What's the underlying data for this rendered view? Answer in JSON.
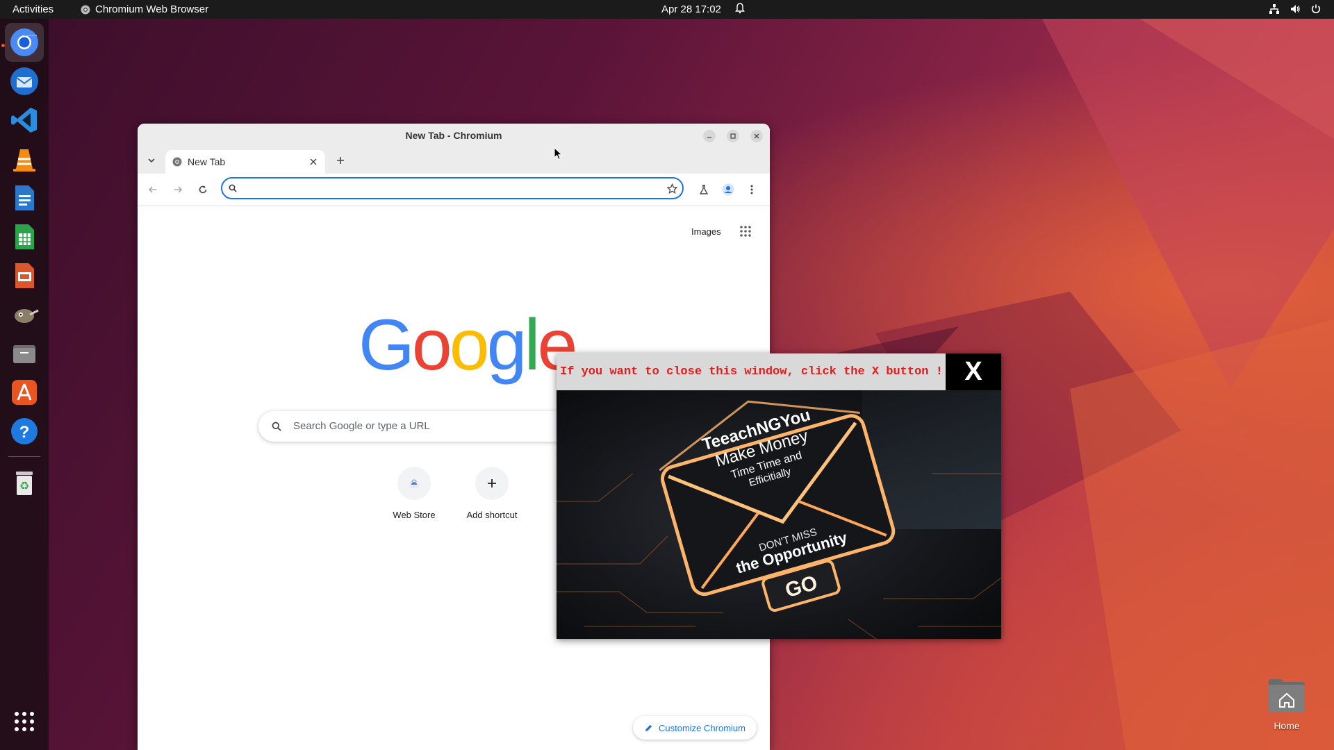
{
  "topbar": {
    "activities": "Activities",
    "app_name": "Chromium Web Browser",
    "clock": "Apr 28  17:02"
  },
  "dock": {
    "items": [
      "chromium-icon",
      "thunderbird-icon",
      "vscode-icon",
      "vlc-icon",
      "writer-icon",
      "calc-icon",
      "impress-icon",
      "gimp-icon",
      "files-icon",
      "app-center-icon",
      "help-icon",
      "trash-icon",
      "show-apps-icon"
    ]
  },
  "window": {
    "title": "New Tab - Chromium",
    "tab_label": "New Tab",
    "omnibox_value": ""
  },
  "ntp": {
    "images_link": "Images",
    "search_placeholder": "Search Google or type a URL",
    "logo": [
      "G",
      "o",
      "o",
      "g",
      "l",
      "e"
    ],
    "shortcuts": [
      {
        "label": "Web Store"
      },
      {
        "label": "Add shortcut"
      }
    ],
    "customize_label": "Customize Chromium"
  },
  "popup": {
    "message": "If you want to close this window, click the X button !",
    "close_label": "X",
    "art_text": {
      "line1": "TeeachNGYou",
      "line2": "Make Money",
      "line3": "Time Time and",
      "line4": "Efficitially",
      "line5": "DON'T MISS",
      "line6": "the Opportunity",
      "go": "GO"
    }
  },
  "desktop": {
    "home_label": "Home"
  },
  "colors": {
    "topbar": "#1b1b1b",
    "accent_blue": "#1a73e8",
    "popup_message": "#e31b1b",
    "google_blue": "#4285f4",
    "google_red": "#ea4335",
    "google_yellow": "#fbbc05",
    "google_green": "#34a853"
  }
}
